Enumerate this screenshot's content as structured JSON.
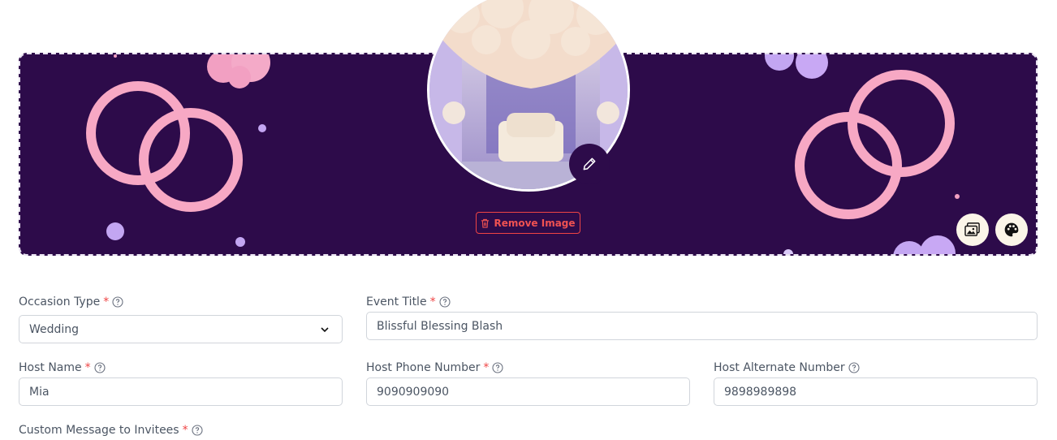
{
  "banner": {
    "remove_image_label": "Remove Image",
    "colors": {
      "background": "#2d0b4a",
      "rings": "#f7a8c4",
      "bubbles": "#c3a6f2",
      "remove_text": "#f05252"
    },
    "icons": [
      "pencil-icon",
      "trash-icon",
      "image-gallery-icon",
      "palette-icon"
    ]
  },
  "form": {
    "occasion_type": {
      "label": "Occasion Type",
      "required": "*",
      "value": "Wedding"
    },
    "event_title": {
      "label": "Event Title",
      "required": "*",
      "value": "Blissful Blessing Blash"
    },
    "host_name": {
      "label": "Host Name",
      "required": "*",
      "value": "Mia"
    },
    "host_phone": {
      "label": "Host Phone Number",
      "required": "*",
      "value": "9090909090"
    },
    "host_alt": {
      "label": "Host Alternate Number",
      "value": "9898989898"
    },
    "custom_message": {
      "label": "Custom Message to Invitees",
      "required": "*"
    }
  }
}
